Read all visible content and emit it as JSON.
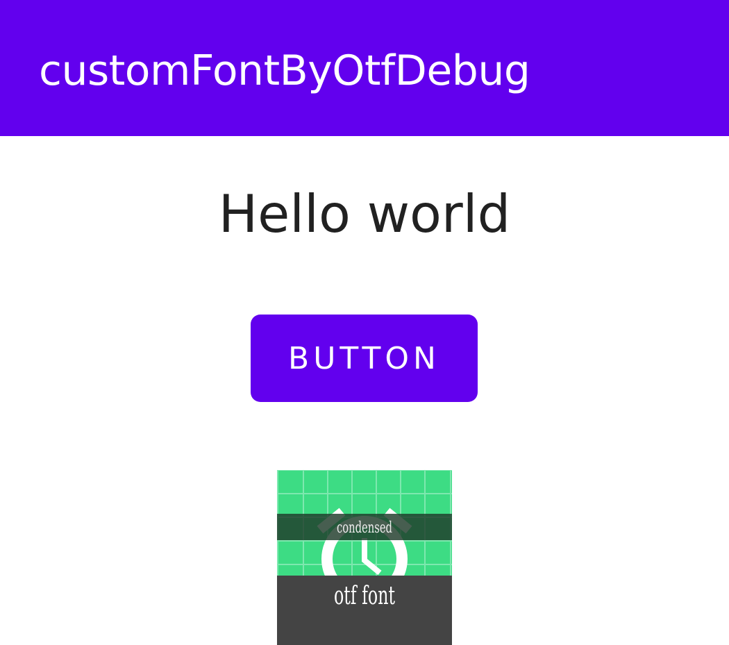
{
  "app_bar": {
    "title": "customFontByOtfDebug",
    "color": "#6200EE"
  },
  "main": {
    "hello_text": "Hello world",
    "button_label": "BUTTON",
    "button_color": "#6200EE",
    "image": {
      "icon": "alarm-clock-icon",
      "background_color": "#3DDC84",
      "label_top": "condensed",
      "label_bottom": "otf font"
    }
  }
}
